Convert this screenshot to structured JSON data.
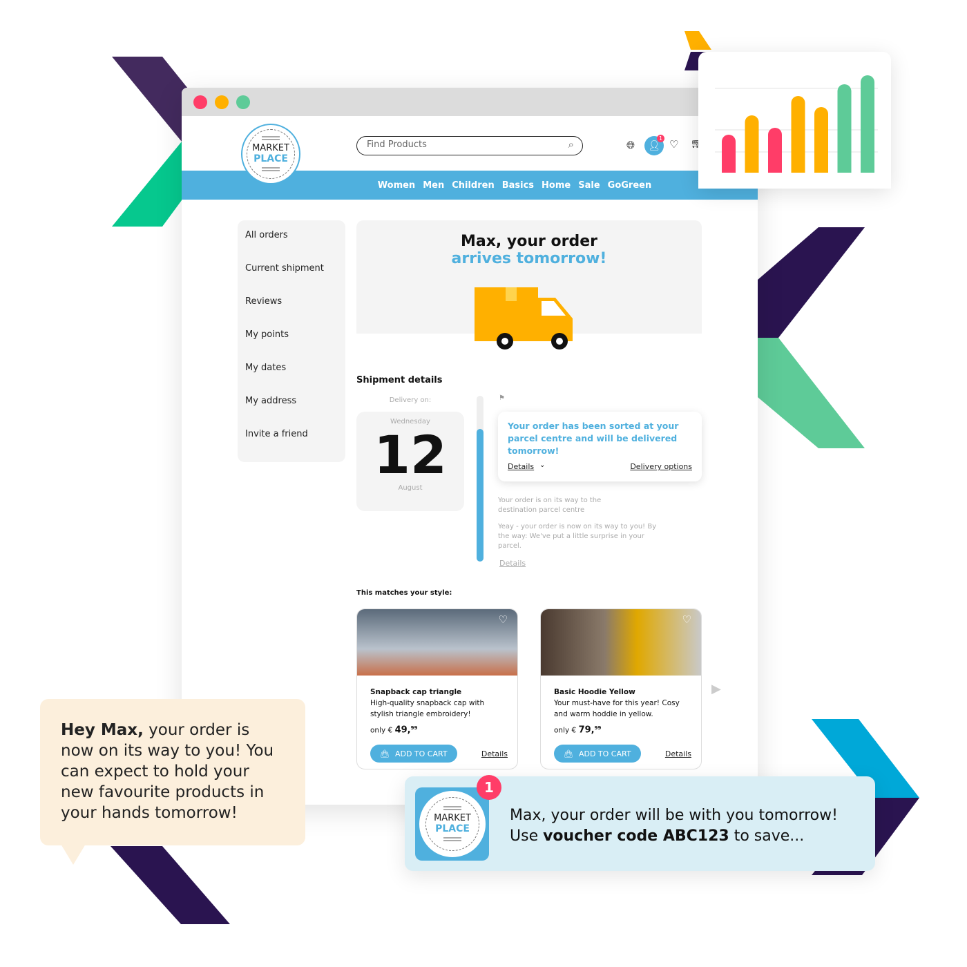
{
  "window": {
    "traffic_lights": [
      "#ff3d68",
      "#ffb000",
      "#5ecb98"
    ]
  },
  "logo": {
    "line1": "MARKET",
    "line2": "PLACE"
  },
  "search": {
    "placeholder": "Find Products"
  },
  "header": {
    "notification_count": "1"
  },
  "nav": [
    "Women",
    "Men",
    "Children",
    "Basics",
    "Home",
    "Sale",
    "GoGreen"
  ],
  "sidebar": [
    "All orders",
    "Current shipment",
    "Reviews",
    "My points",
    "My dates",
    "My address",
    "Invite a friend"
  ],
  "hero": {
    "line1": "Max, your order",
    "line2": "arrives tomorrow!"
  },
  "shipment": {
    "title": "Shipment details",
    "delivery_label": "Delivery on:",
    "weekday": "Wednesday",
    "day": "12",
    "month": "August",
    "progress_percent": 80,
    "status_main": "Your order has been sorted at your parcel centre and will be delivered tomorrow!",
    "details": "Details",
    "delivery_options": "Delivery options",
    "status_2": "Your order is on its way to the destination parcel centre",
    "status_3": "Yeay - your order is now on its way to you! By the way: We've put a little surprise in your parcel.",
    "details_2": "Details"
  },
  "recommend": {
    "title": "This matches your style:",
    "products": [
      {
        "name": "Snapback cap triangle",
        "desc": "High-quality snapback cap with stylish triangle embroidery!",
        "price_prefix": "only €",
        "price": "49,",
        "cents": "99",
        "add": "ADD TO CART",
        "details": "Details"
      },
      {
        "name": "Basic Hoodie Yellow",
        "desc": "Your must-have for this year! Cosy and warm hoddie in yellow.",
        "price_prefix": "only €",
        "price": "79,",
        "cents": "99",
        "add": "ADD TO CART",
        "details": "Details"
      }
    ]
  },
  "bubble": {
    "bold": "Hey Max,",
    "text": " your order is now on its way to you! You can expect to hold your new favourite products in your hands tomorrow!"
  },
  "push": {
    "badge": "1",
    "line1": "Max, your order will be with you tomorrow!",
    "pre": "Use ",
    "bold": "voucher code ABC123",
    "post": " to save..."
  },
  "mini_chart": {
    "bars": [
      {
        "value": 55,
        "color": "#ff3d68"
      },
      {
        "value": 83,
        "color": "#ffb000"
      },
      {
        "value": 65,
        "color": "#ff3d68"
      },
      {
        "value": 111,
        "color": "#ffb000"
      },
      {
        "value": 95,
        "color": "#ffb000"
      },
      {
        "value": 128,
        "color": "#5ecb98"
      },
      {
        "value": 141,
        "color": "#5ecb98"
      }
    ]
  }
}
